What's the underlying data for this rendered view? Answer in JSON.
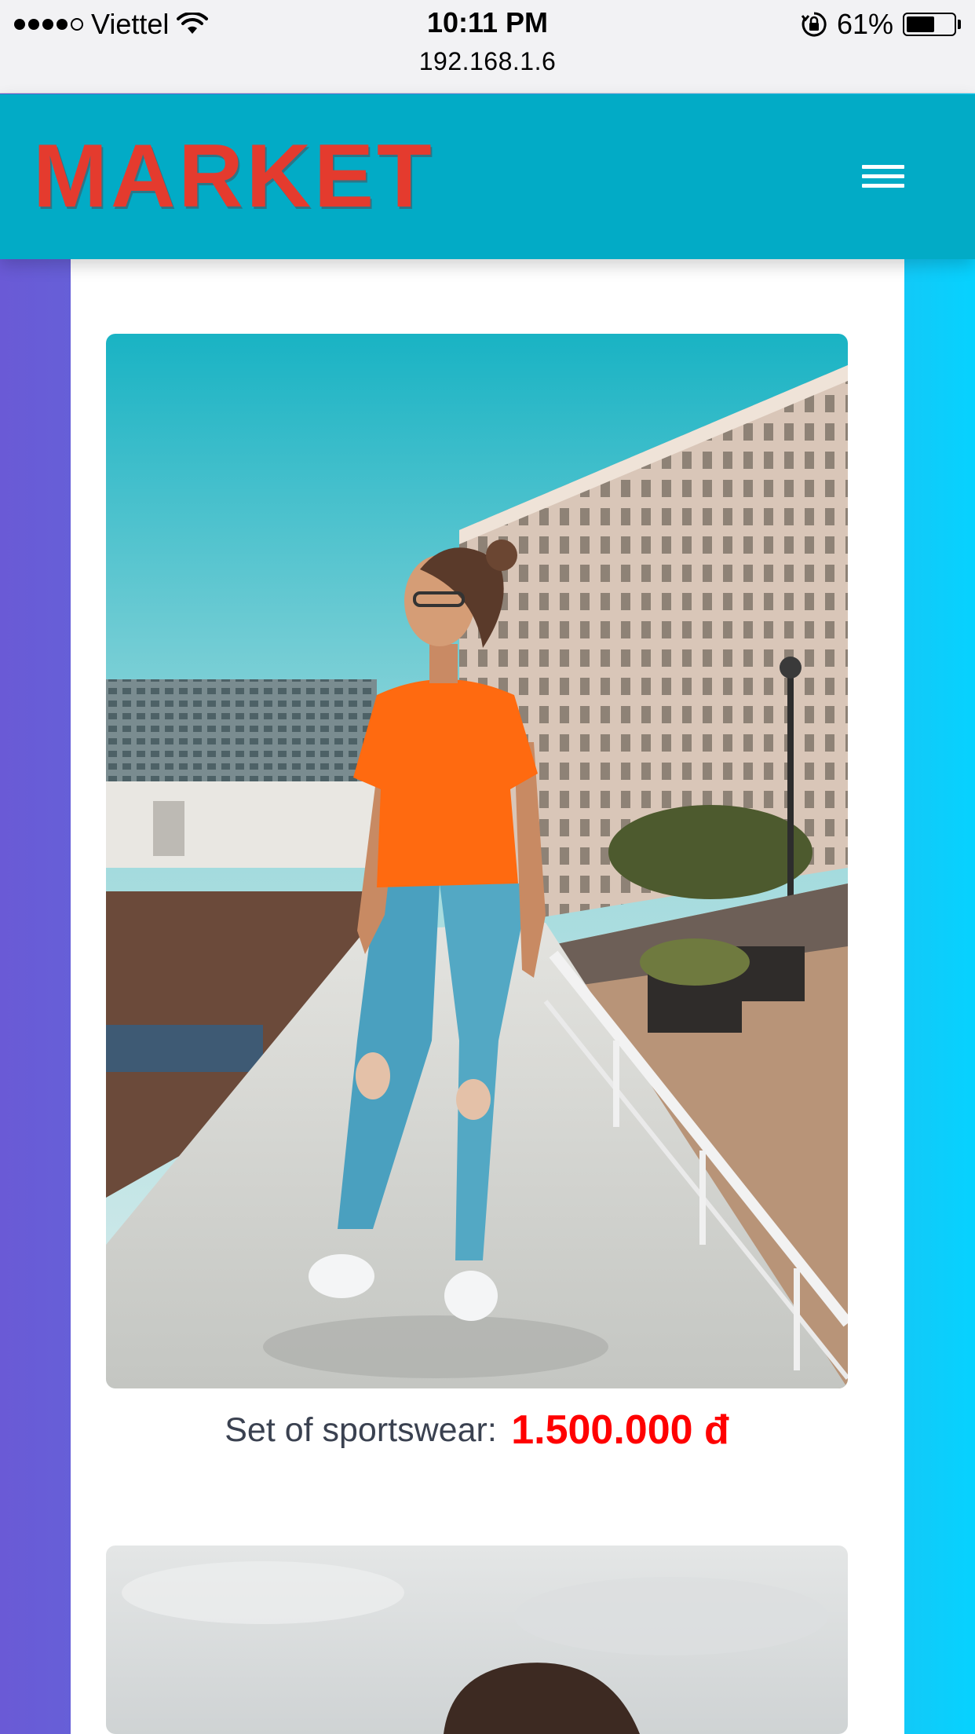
{
  "status_bar": {
    "carrier": "Viettel",
    "time": "10:11 PM",
    "url": "192.168.1.6",
    "battery": "61%",
    "battery_level": 0.61,
    "signal_bars": 4,
    "signal_max": 5,
    "icons": [
      "signal-dots-icon",
      "wifi-icon",
      "rotation-lock-icon",
      "battery-icon"
    ]
  },
  "header": {
    "logo": "MARKET",
    "menu_icon": "hamburger-menu-icon",
    "background_color": "#02abc6",
    "logo_color": "#e43b2e"
  },
  "products": [
    {
      "name": "Set of sportswear:",
      "price": "1.500.000 đ",
      "price_color": "#ff0000"
    },
    {
      "name": "",
      "price": ""
    }
  ]
}
